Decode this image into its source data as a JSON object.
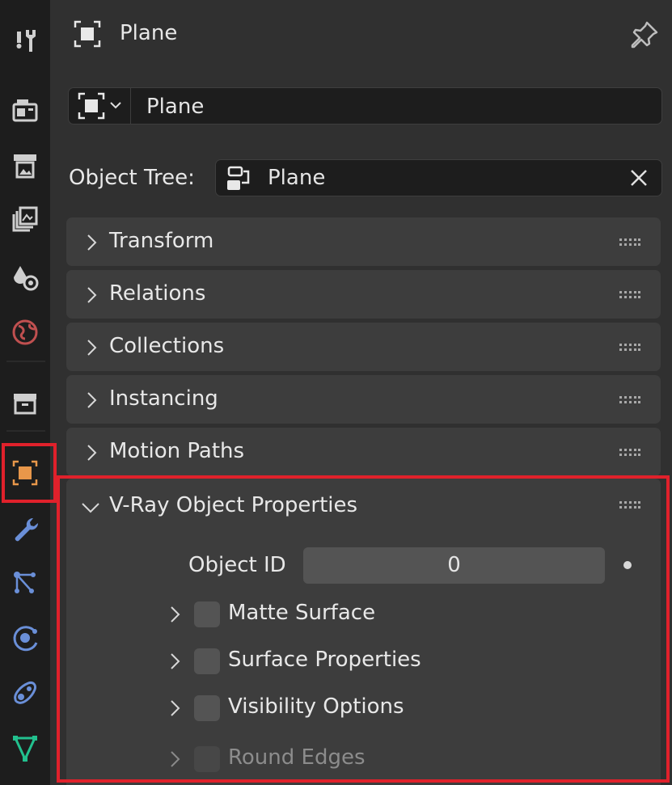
{
  "header": {
    "title": "Plane"
  },
  "datablock": {
    "name": "Plane"
  },
  "object_tree": {
    "label": "Object Tree:",
    "value": "Plane"
  },
  "panels": [
    {
      "title": "Transform"
    },
    {
      "title": "Relations"
    },
    {
      "title": "Collections"
    },
    {
      "title": "Instancing"
    },
    {
      "title": "Motion Paths"
    }
  ],
  "vray": {
    "title": "V-Ray Object Properties",
    "object_id_label": "Object ID",
    "object_id_value": "0",
    "subpanels": [
      {
        "label": "Matte Surface"
      },
      {
        "label": "Surface Properties"
      },
      {
        "label": "Visibility Options"
      },
      {
        "label": "Round Edges"
      }
    ]
  },
  "sidebar_tabs": [
    "tool-icon",
    "render-icon",
    "output-icon",
    "view-layer-icon",
    "scene-icon",
    "world-icon",
    "collection-icon",
    "object-icon",
    "modifier-icon",
    "particles-icon",
    "physics-icon",
    "constraints-icon",
    "data-icon"
  ],
  "colors": {
    "accent_orange": "#e8974a",
    "highlight_red": "#e0212b",
    "modifier_blue": "#6a8fd8",
    "data_green": "#22c08e",
    "world_red": "#c05050"
  }
}
